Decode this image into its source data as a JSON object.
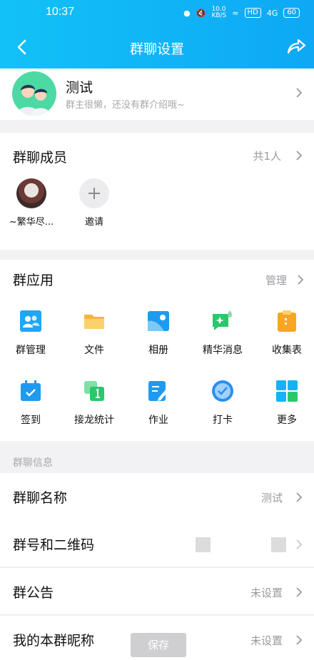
{
  "status_bar": {
    "time": "10:37",
    "network_speed": "10.0\nKB/S",
    "hd": "HD",
    "signal": "4G",
    "battery": "60"
  },
  "nav": {
    "title": "群聊设置"
  },
  "profile": {
    "name": "测试",
    "description": "群主很懒，还没有群介绍哦~"
  },
  "members": {
    "title": "群聊成员",
    "count": "共1人",
    "items": [
      {
        "name": "~繁华尽..."
      },
      {
        "name": "邀请"
      }
    ]
  },
  "apps": {
    "title": "群应用",
    "manage": "管理",
    "items": [
      {
        "label": "群管理",
        "icon": "group-manage-icon",
        "color": "#1ea7f4"
      },
      {
        "label": "文件",
        "icon": "folder-icon",
        "color": "#f6b63c"
      },
      {
        "label": "相册",
        "icon": "album-icon",
        "color": "#1e9bf0"
      },
      {
        "label": "精华消息",
        "icon": "highlight-message-icon",
        "color": "#2cc76b"
      },
      {
        "label": "收集表",
        "icon": "clipboard-icon",
        "color": "#f6a623"
      },
      {
        "label": "签到",
        "icon": "calendar-icon",
        "color": "#1e9bf0"
      },
      {
        "label": "接龙统计",
        "icon": "chain-count-icon",
        "color": "#2cc76b"
      },
      {
        "label": "作业",
        "icon": "homework-icon",
        "color": "#1e9bf0"
      },
      {
        "label": "打卡",
        "icon": "checkin-icon",
        "color": "#2b8ff2"
      },
      {
        "label": "更多",
        "icon": "more-grid-icon",
        "color": "#14b3f1"
      }
    ]
  },
  "info": {
    "section_label": "群聊信息",
    "rows": [
      {
        "title": "群聊名称",
        "value": "测试"
      },
      {
        "title": "群号和二维码",
        "value": ""
      },
      {
        "title": "群公告",
        "value": "未设置"
      },
      {
        "title": "我的本群昵称",
        "value": "未设置"
      }
    ]
  },
  "save_label": "保存"
}
